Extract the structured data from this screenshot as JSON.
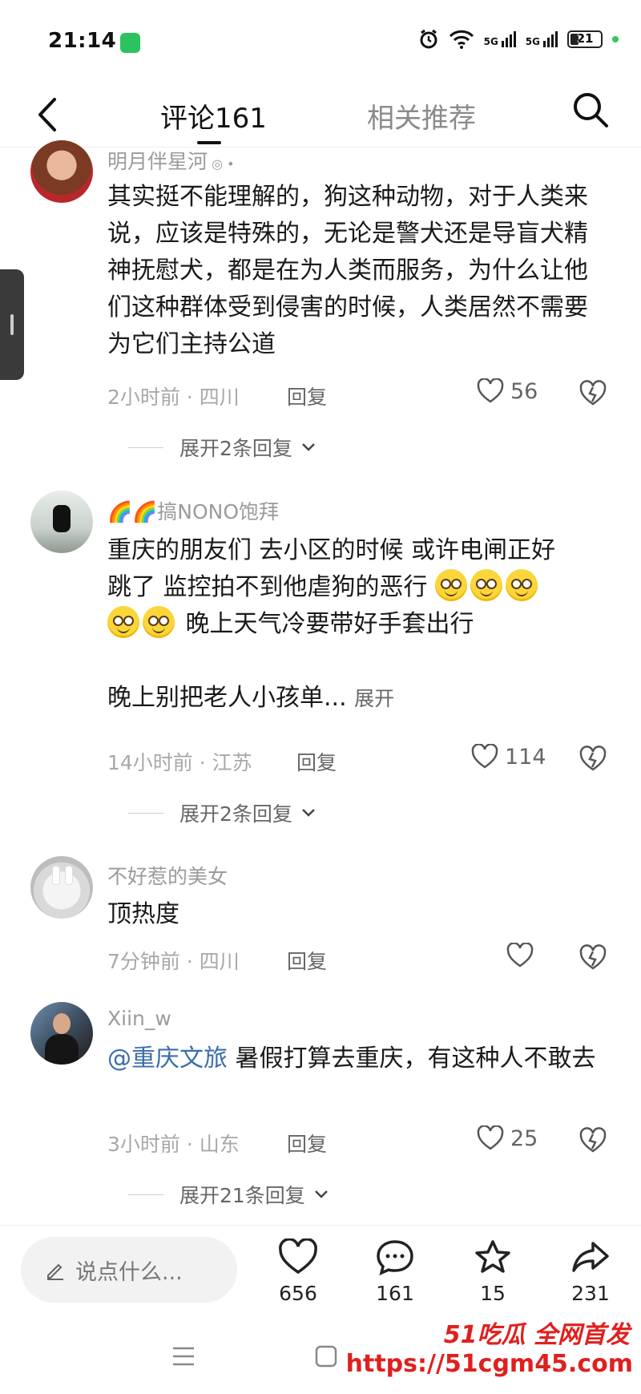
{
  "status_bar": {
    "time": "21:14",
    "signal1": "5G",
    "signal2": "5G",
    "battery": "21"
  },
  "header": {
    "tab_comments": "评论161",
    "tab_related": "相关推荐"
  },
  "comments": [
    {
      "username": "明月伴星河",
      "body": "其实挺不能理解的，狗这种动物，对于人类来说，应该是特殊的，无论是警犬还是导盲犬精神抚慰犬，都是在为人类而服务，为什么让他们这种群体受到侵害的时候，人类居然不需要为它们主持公道",
      "meta": "2小时前 · 四川",
      "reply": "回复",
      "likes": "56",
      "expand": "展开2条回复"
    },
    {
      "username": "🌈🌈搞NONO饱拜",
      "body_line1": "重庆的朋友们 去小区的时候 或许电闸正好",
      "body_line2": "跳了 监控拍不到他虐狗的恶行",
      "body_line3": "晚上天气冷要带好手套出行",
      "body_line4": "晚上别把老人小孩单...",
      "more": "展开",
      "meta": "14小时前 · 江苏",
      "reply": "回复",
      "likes": "114",
      "expand": "展开2条回复"
    },
    {
      "username": "不好惹的美女",
      "body": "顶热度",
      "meta": "7分钟前 · 四川",
      "reply": "回复"
    },
    {
      "username": "Xiin_w",
      "mention": "@重庆文旅",
      "body": " 暑假打算去重庆，有这种人不敢去",
      "meta": "3小时前 · 山东",
      "reply": "回复",
      "likes": "25",
      "expand": "展开21条回复"
    }
  ],
  "bottom_bar": {
    "input_placeholder": "说点什么...",
    "likes": "656",
    "comments": "161",
    "favorites": "15",
    "shares": "231"
  },
  "watermark": {
    "line1": "51吃瓜 全网首发",
    "line2": "https://51cgm45.com"
  }
}
